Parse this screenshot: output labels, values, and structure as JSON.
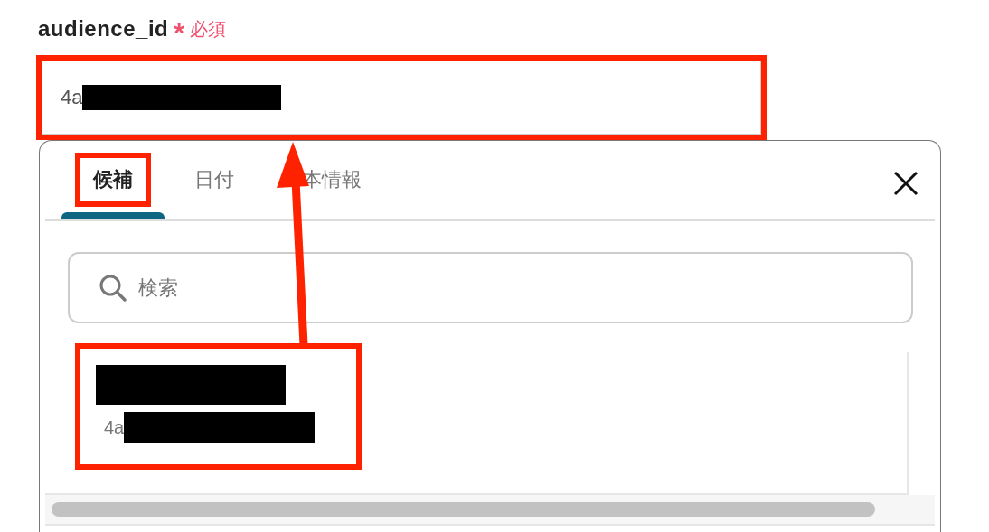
{
  "field": {
    "label": "audience_id",
    "required_mark": "*",
    "required_text": "必須",
    "value": "4a",
    "value_redacted": true,
    "highlighted": true
  },
  "popup": {
    "tabs": [
      {
        "label": "候補",
        "selected": true,
        "highlighted": true
      },
      {
        "label": "日付",
        "selected": false,
        "highlighted": false
      },
      {
        "label": "本情報",
        "selected": false,
        "highlighted": false
      }
    ],
    "search": {
      "placeholder": "検索"
    },
    "items": [
      {
        "title_redacted": true,
        "value": "4a",
        "value_redacted": true,
        "highlighted": true
      }
    ]
  },
  "annotation_arrow": {
    "kind": "arrow"
  }
}
